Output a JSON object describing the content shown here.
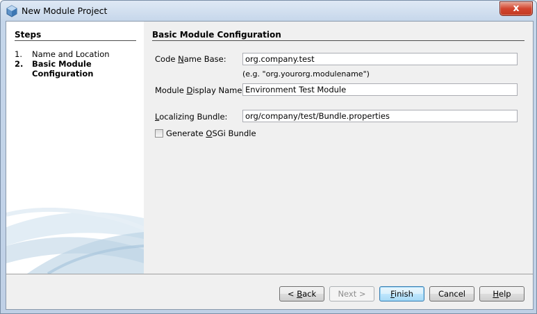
{
  "window": {
    "title": "New Module Project",
    "close_label": "x"
  },
  "steps": {
    "title": "Steps",
    "items": [
      {
        "number": "1.",
        "label": "Name and Location",
        "current": false
      },
      {
        "number": "2.",
        "label": "Basic Module Configuration",
        "current": true
      }
    ]
  },
  "config": {
    "title": "Basic Module Configuration",
    "code_name_base": {
      "label_pre": "Code ",
      "label_mnemonic": "N",
      "label_post": "ame Base:",
      "value": "org.company.test"
    },
    "hint": "(e.g. \"org.yourorg.modulename\")",
    "display_name": {
      "label_pre": "Module ",
      "label_mnemonic": "D",
      "label_post": "isplay Name:",
      "value": "Environment Test Module"
    },
    "localizing_bundle": {
      "label_pre": "",
      "label_mnemonic": "L",
      "label_post": "ocalizing Bundle:",
      "value": "org/company/test/Bundle.properties"
    },
    "osgi_checkbox": {
      "label_pre": "Generate ",
      "label_mnemonic": "O",
      "label_post": "SGi Bundle",
      "checked": false
    }
  },
  "buttons": {
    "back": {
      "pre": "< ",
      "mnemonic": "B",
      "post": "ack"
    },
    "next": {
      "pre": "Next >",
      "mnemonic": "",
      "post": ""
    },
    "finish": {
      "pre": "",
      "mnemonic": "F",
      "post": "inish"
    },
    "cancel": {
      "pre": "Cancel",
      "mnemonic": "",
      "post": ""
    },
    "help": {
      "pre": "",
      "mnemonic": "H",
      "post": "elp"
    }
  },
  "colors": {
    "titlebar": "#c5d6ea",
    "close_button": "#d2452f",
    "panel": "#f0f0f0",
    "default_button": "#bee6fd"
  },
  "icons": {
    "app": "netbeans-cube-icon",
    "decoration": "wizard-swoosh-graphic"
  }
}
